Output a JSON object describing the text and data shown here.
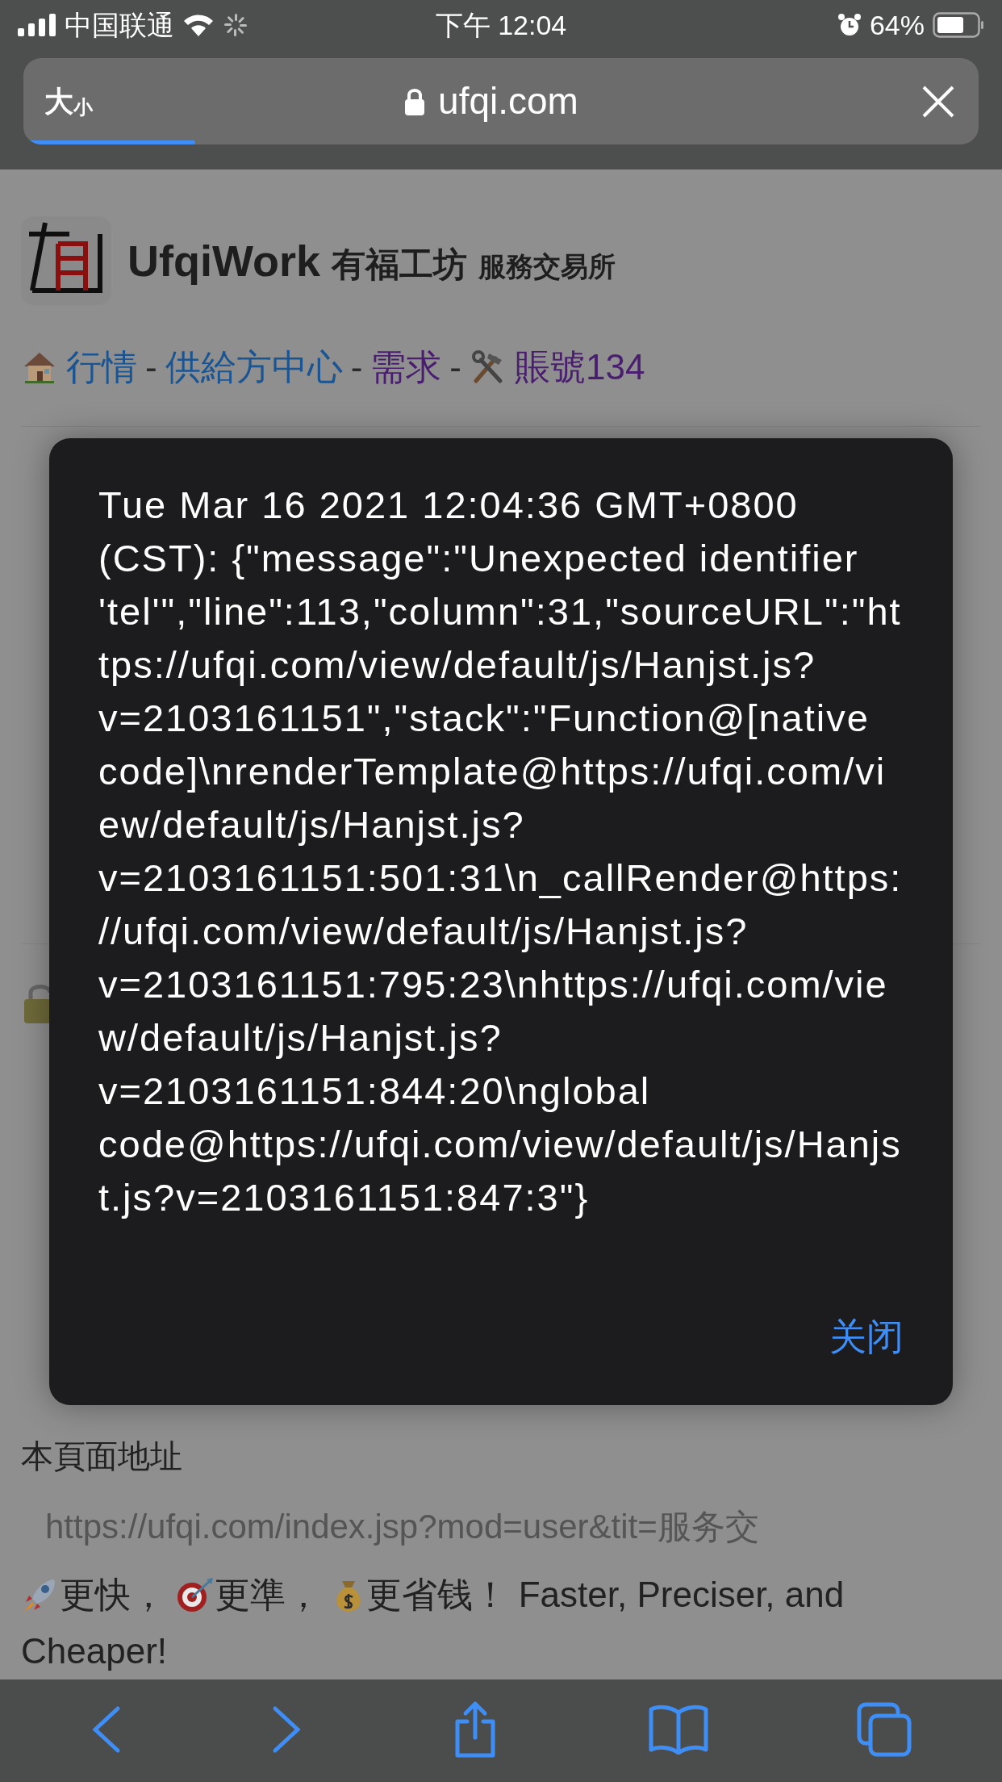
{
  "status_bar": {
    "carrier": "中国联通",
    "time": "下午 12:04",
    "battery": "64%"
  },
  "address_bar": {
    "text_size_big": "大",
    "text_size_small": "小",
    "url": "ufqi.com",
    "level": 0.18
  },
  "site_header": {
    "brand": "UfqiWork",
    "name": "有福工坊",
    "tagline": "服務交易所"
  },
  "nav": [
    {
      "label": "行情",
      "kind": "home",
      "color": "#1a5592"
    },
    {
      "label": "供給方中心",
      "kind": "plain",
      "color": "#1a5592"
    },
    {
      "label": "需求",
      "kind": "plain",
      "color": "#4a1e6e"
    },
    {
      "label": "賬號134",
      "kind": "tools",
      "color": "#4a1e6e"
    }
  ],
  "nav_separator": "-",
  "alert": {
    "message": "Tue Mar 16 2021 12:04:36 GMT+0800 (CST): {\"message\":\"Unexpected identifier 'tel'\",\"line\":113,\"column\":31,\"sourceURL\":\"https://ufqi.com/view/default/js/Hanjst.js?v=2103161151\",\"stack\":\"Function@[native code]\\nrenderTemplate@https://ufqi.com/view/default/js/Hanjst.js?v=2103161151:501:31\\n_callRender@https://ufqi.com/view/default/js/Hanjst.js?v=2103161151:795:23\\nhttps://ufqi.com/view/default/js/Hanjst.js?v=2103161151:844:20\\nglobal code@https://ufqi.com/view/default/js/Hanjst.js?v=2103161151:847:3\"}",
    "close_button": "关闭"
  },
  "page_address": {
    "label": "本頁面地址",
    "url": "https://ufqi.com/index.jsp?mod=user&tit=服务交"
  },
  "slogan": [
    {
      "text": "更快，",
      "kind": "rocket"
    },
    {
      "text": "更準，",
      "kind": "target"
    },
    {
      "text": "更省钱！",
      "kind": "money"
    },
    {
      "text": "Faster, Preciser, and Cheaper!",
      "kind": "plain"
    }
  ]
}
